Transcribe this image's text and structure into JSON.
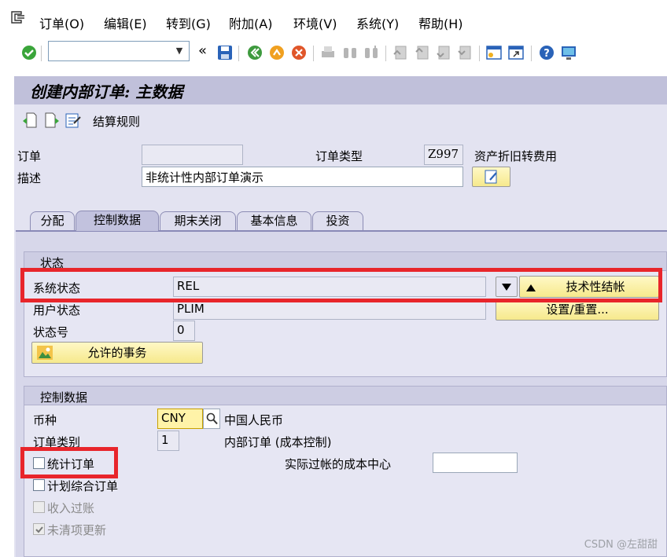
{
  "menu": {
    "items": [
      "订单(O)",
      "编辑(E)",
      "转到(G)",
      "附加(A)",
      "环境(V)",
      "系统(Y)",
      "帮助(H)"
    ]
  },
  "toolbar": {
    "back_chevrons": "«"
  },
  "screen": {
    "title": "创建内部订单: 主数据"
  },
  "app_toolbar": {
    "settlement_rule": "结算规则"
  },
  "header": {
    "order_label": "订单",
    "order_value": "",
    "order_type_label": "订单类型",
    "order_type_value": "Z997",
    "order_type_desc": "资产折旧转费用",
    "description_label": "描述",
    "description_value": "非统计性内部订单演示"
  },
  "tabs": [
    {
      "label": "分配",
      "active": false
    },
    {
      "label": "控制数据",
      "active": true
    },
    {
      "label": "期末关闭",
      "active": false
    },
    {
      "label": "基本信息",
      "active": false
    },
    {
      "label": "投资",
      "active": false
    }
  ],
  "status_group": {
    "title": "状态",
    "system_status_label": "系统状态",
    "system_status_value": "REL",
    "tech_complete_button": "技术性结帐",
    "user_status_label": "用户状态",
    "user_status_value": "PLIM",
    "set_reset_button": "设置/重置...",
    "status_number_label": "状态号",
    "status_number_value": "0",
    "allowed_transactions_button": "允许的事务"
  },
  "control_group": {
    "title": "控制数据",
    "currency_label": "币种",
    "currency_value": "CNY",
    "currency_desc": "中国人民币",
    "order_category_label": "订单类别",
    "order_category_value": "1",
    "order_category_desc": "内部订单 (成本控制)",
    "statistical_order_label": "统计订单",
    "statistical_order_checked": false,
    "actual_posted_cc_label": "实际过帐的成本中心",
    "actual_posted_cc_value": "",
    "plan_integrated_label": "计划综合订单",
    "plan_integrated_checked": false,
    "revenue_postings_label": "收入过账",
    "revenue_postings_checked": false,
    "commitment_update_label": "未清项更新",
    "commitment_update_checked": true
  },
  "watermark": "CSDN @左甜甜",
  "colors": {
    "highlight_red": "#e8252b",
    "screen_bg": "#e3e3f1",
    "title_bar": "#c0c0da",
    "button_yellow": "#f6e98c"
  }
}
